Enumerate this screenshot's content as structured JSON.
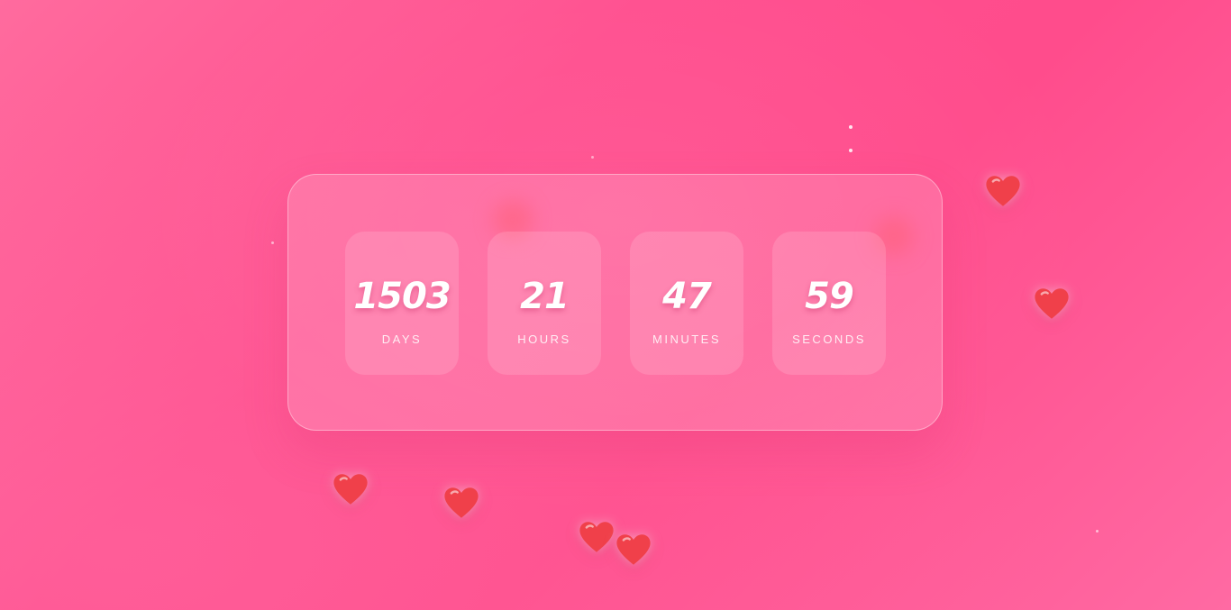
{
  "countdown": {
    "days": {
      "value": "1503",
      "label": "DAYS"
    },
    "hours": {
      "value": "21",
      "label": "HOURS"
    },
    "minutes": {
      "value": "47",
      "label": "MINUTES"
    },
    "seconds": {
      "value": "59",
      "label": "SECONDS"
    }
  },
  "colors": {
    "background_start": "#ff6b9e",
    "background_end": "#ff4c8c",
    "heart": "#f0404a",
    "text": "#ffffff"
  },
  "decorations": {
    "icon": "heart-icon",
    "heart_count": 7
  }
}
